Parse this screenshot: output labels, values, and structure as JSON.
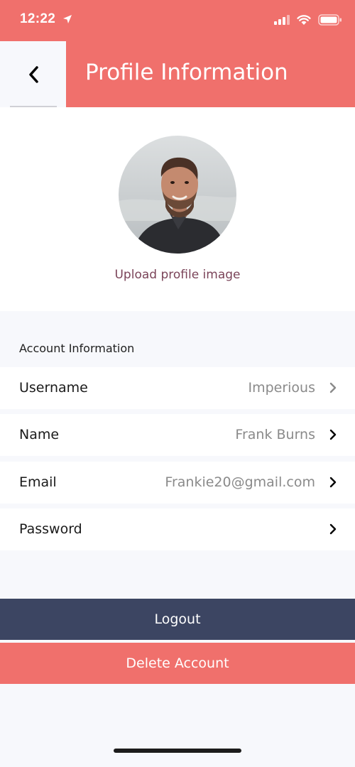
{
  "status_bar": {
    "time": "12:22"
  },
  "header": {
    "title": "Profile Information"
  },
  "profile": {
    "upload_label": "Upload profile image"
  },
  "account": {
    "section_title": "Account Information",
    "rows": [
      {
        "label": "Username",
        "value": "Imperious"
      },
      {
        "label": "Name",
        "value": "Frank Burns"
      },
      {
        "label": "Email",
        "value": "Frankie20@gmail.com"
      },
      {
        "label": "Password",
        "value": ""
      }
    ]
  },
  "actions": {
    "logout_label": "Logout",
    "delete_label": "Delete Account"
  },
  "colors": {
    "accent": "#f0706c",
    "dark_button": "#3c4562",
    "upload_link": "#7b4459",
    "background": "#f7f8fc"
  }
}
